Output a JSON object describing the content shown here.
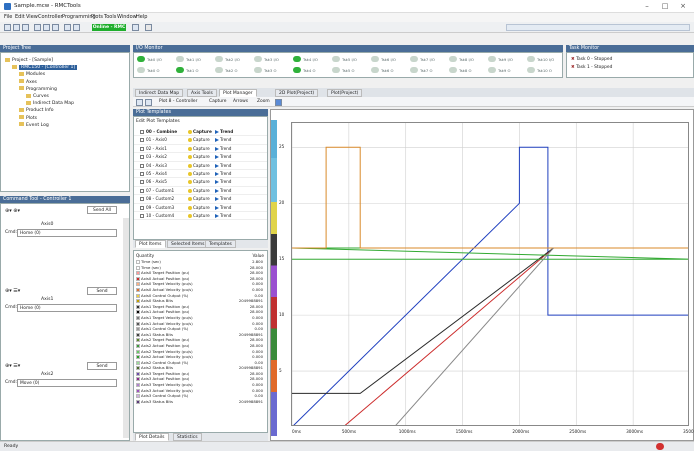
{
  "window": {
    "title": "Sample.mcw - RMCTools",
    "minimize": "–",
    "maximize": "□",
    "close": "×"
  },
  "menu": [
    "File",
    "Edit",
    "View",
    "Controller",
    "Programming",
    "Plots",
    "Tools",
    "Window",
    "Help"
  ],
  "toolbar": {
    "online_label": "Online - RMC"
  },
  "project": {
    "header": "Project Tree",
    "items": [
      {
        "label": "Project - [Sample]",
        "indent": 0
      },
      {
        "label": "RMC150 - [Controller 1]",
        "indent": 1,
        "selected": true
      },
      {
        "label": "Modules",
        "indent": 2
      },
      {
        "label": "Axes",
        "indent": 2
      },
      {
        "label": "Programming",
        "indent": 2
      },
      {
        "label": "Curves",
        "indent": 3
      },
      {
        "label": "Indirect Data Map",
        "indent": 3
      },
      {
        "label": "Product Info",
        "indent": 2
      },
      {
        "label": "Plots",
        "indent": 2
      },
      {
        "label": "Event Log",
        "indent": 2
      }
    ]
  },
  "io": {
    "header": "I/O Monitor",
    "leds": [
      {
        "row": 0,
        "label": "Tsk0 I/O",
        "on": true
      },
      {
        "row": 0,
        "label": "Tsk1 I/O",
        "on": false
      },
      {
        "row": 0,
        "label": "Tsk2 I/O",
        "on": false
      },
      {
        "row": 0,
        "label": "Tsk3 I/O",
        "on": false
      },
      {
        "row": 0,
        "label": "Tsk4 I/O",
        "on": true
      },
      {
        "row": 0,
        "label": "Tsk5 I/O",
        "on": false
      },
      {
        "row": 0,
        "label": "Tsk6 I/O",
        "on": false
      },
      {
        "row": 0,
        "label": "Tsk7 I/O",
        "on": false
      },
      {
        "row": 0,
        "label": "Tsk8 I/O",
        "on": false
      },
      {
        "row": 0,
        "label": "Tsk9 I/O",
        "on": false
      },
      {
        "row": 0,
        "label": "Tsk10 I/O",
        "on": false
      },
      {
        "row": 1,
        "label": "Tsk0 O",
        "on": false
      },
      {
        "row": 1,
        "label": "Tsk1 O",
        "on": true
      },
      {
        "row": 1,
        "label": "Tsk2 O",
        "on": false
      },
      {
        "row": 1,
        "label": "Tsk3 O",
        "on": false
      },
      {
        "row": 1,
        "label": "Tsk4 O",
        "on": true
      },
      {
        "row": 1,
        "label": "Tsk5 O",
        "on": false
      },
      {
        "row": 1,
        "label": "Tsk6 O",
        "on": false
      },
      {
        "row": 1,
        "label": "Tsk7 O",
        "on": false
      },
      {
        "row": 1,
        "label": "Tsk8 O",
        "on": false
      },
      {
        "row": 1,
        "label": "Tsk9 O",
        "on": false
      },
      {
        "row": 1,
        "label": "Tsk10 O",
        "on": false
      }
    ]
  },
  "taskmon": {
    "header": "Task Monitor",
    "items": [
      "Task 0 - Stopped",
      "Task 1 - Stopped"
    ]
  },
  "tabs": [
    "Indirect Data Map",
    "Axis Tools",
    "Plot Manager",
    "2D Plot(Project)",
    "Plot(Project)"
  ],
  "plot_toolbar": [
    "Plot 8 - Controller",
    "Capture",
    "Arrows",
    "Zoom"
  ],
  "templates": {
    "header": "Plot Templates",
    "title": "Edit Plot Templates",
    "capture_label": "Capture",
    "trend_label": "Trend",
    "rows": [
      "00 - Combine",
      "01 - Axis0",
      "02 - Axis1",
      "03 - Axis2",
      "04 - Axis3",
      "05 - Axis4",
      "06 - Axis5",
      "07 - Custom1",
      "08 - Custom2",
      "09 - Custom3",
      "10 - Custom4"
    ]
  },
  "left_tabs": [
    "Plot Items",
    "Selected Items",
    "Templates"
  ],
  "qty": {
    "header_name": "Quantity",
    "header_val": "Value",
    "rows": [
      {
        "name": "Time (sec)",
        "val": "2.800",
        "color": "#ffffff"
      },
      {
        "name": "Time (sec)",
        "val": "28.000",
        "color": "#ffffff"
      },
      {
        "name": "Axis0 Target Position (pu)",
        "val": "28.000",
        "color": "#ff9999"
      },
      {
        "name": "Axis0 Actual Position (pu)",
        "val": "28.000",
        "color": "#cc2b2b"
      },
      {
        "name": "Axis0 Target Velocity (pu/s)",
        "val": "0.000",
        "color": "#ffb080"
      },
      {
        "name": "Axis0 Actual Velocity (pu/s)",
        "val": "0.000",
        "color": "#e07030"
      },
      {
        "name": "Axis0 Control Output (%)",
        "val": "0.00",
        "color": "#f0d040"
      },
      {
        "name": "Axis0 Status Bits",
        "val": "2049988891",
        "color": "#c0a000"
      },
      {
        "name": "Axis1 Target Position (pu)",
        "val": "28.000",
        "color": "#333333"
      },
      {
        "name": "Axis1 Actual Position (pu)",
        "val": "28.000",
        "color": "#000000"
      },
      {
        "name": "Axis1 Target Velocity (pu/s)",
        "val": "0.000",
        "color": "#7a7a7a"
      },
      {
        "name": "Axis1 Actual Velocity (pu/s)",
        "val": "0.000",
        "color": "#555555"
      },
      {
        "name": "Axis1 Control Output (%)",
        "val": "0.00",
        "color": "#9a9a9a"
      },
      {
        "name": "Axis1 Status Bits",
        "val": "2049988891",
        "color": "#404040"
      },
      {
        "name": "Axis2 Target Position (pu)",
        "val": "28.000",
        "color": "#5a8a2a"
      },
      {
        "name": "Axis2 Actual Position (pu)",
        "val": "28.000",
        "color": "#3a9a3a"
      },
      {
        "name": "Axis2 Target Velocity (pu/s)",
        "val": "0.000",
        "color": "#66cc66"
      },
      {
        "name": "Axis2 Actual Velocity (pu/s)",
        "val": "0.000",
        "color": "#2aa02a"
      },
      {
        "name": "Axis2 Control Output (%)",
        "val": "0.00",
        "color": "#99dd99"
      },
      {
        "name": "Axis2 Status Bits",
        "val": "2049988891",
        "color": "#4a6a2a"
      },
      {
        "name": "Axis3 Target Position (pu)",
        "val": "28.000",
        "color": "#6a4aaa"
      },
      {
        "name": "Axis3 Actual Position (pu)",
        "val": "28.000",
        "color": "#8a2a8a"
      },
      {
        "name": "Axis3 Target Velocity (pu/s)",
        "val": "0.000",
        "color": "#b080d0"
      },
      {
        "name": "Axis3 Actual Velocity (pu/s)",
        "val": "0.000",
        "color": "#a050c0"
      },
      {
        "name": "Axis3 Control Output (%)",
        "val": "0.00",
        "color": "#d0b0e0"
      },
      {
        "name": "Axis3 Status Bits",
        "val": "2049988891",
        "color": "#5a3a7a"
      }
    ]
  },
  "plot_details_tabs": [
    "Plot Details",
    "Statistics"
  ],
  "cmdtool": {
    "header": "Command Tool - Controller 1",
    "send": "Send All",
    "blocks": [
      {
        "axis": "Axis0",
        "cmd_label": "Cmd:",
        "cmd_value": "Home (0)",
        "send": "Send"
      },
      {
        "axis": "Axis1",
        "cmd_label": "Cmd:",
        "cmd_value": "Home (0)",
        "send": "Send"
      },
      {
        "axis": "Axis2",
        "cmd_label": "Cmd:",
        "cmd_value": "Move (0)",
        "send": "Send"
      }
    ]
  },
  "statusbar": {
    "text": "Ready"
  },
  "chart_data": {
    "type": "line",
    "x_tick_labels": [
      "0ms",
      "500ms",
      "1000ms",
      "1500ms",
      "2000ms",
      "2500ms",
      "3000ms",
      "3500ms"
    ],
    "y_tick_labels": [
      "25",
      "20",
      "15",
      "10",
      "5",
      ""
    ],
    "grid": true,
    "series": [
      {
        "color": "#1f3fbf",
        "points": [
          [
            0,
            0
          ],
          [
            2000,
            20
          ],
          [
            2000,
            25
          ],
          [
            2250,
            25
          ],
          [
            2250,
            10
          ],
          [
            3500,
            10
          ]
        ]
      },
      {
        "color": "#cc2b2b",
        "points": [
          [
            0,
            0
          ],
          [
            450,
            0
          ],
          [
            2300,
            16
          ],
          [
            3500,
            16
          ]
        ]
      },
      {
        "color": "#2a2a2a",
        "points": [
          [
            0,
            3
          ],
          [
            600,
            3
          ],
          [
            2300,
            16
          ],
          [
            3500,
            16
          ]
        ]
      },
      {
        "color": "#33aa33",
        "points": [
          [
            0,
            15
          ],
          [
            3500,
            15
          ],
          [
            0,
            16
          ],
          [
            3000,
            16
          ]
        ]
      },
      {
        "color": "#d98a2a",
        "points": [
          [
            0,
            16
          ],
          [
            300,
            16
          ],
          [
            300,
            25
          ],
          [
            600,
            25
          ],
          [
            600,
            16
          ],
          [
            3500,
            16
          ]
        ]
      },
      {
        "color": "#888888",
        "points": [
          [
            900,
            0
          ],
          [
            2300,
            16
          ]
        ]
      }
    ]
  }
}
